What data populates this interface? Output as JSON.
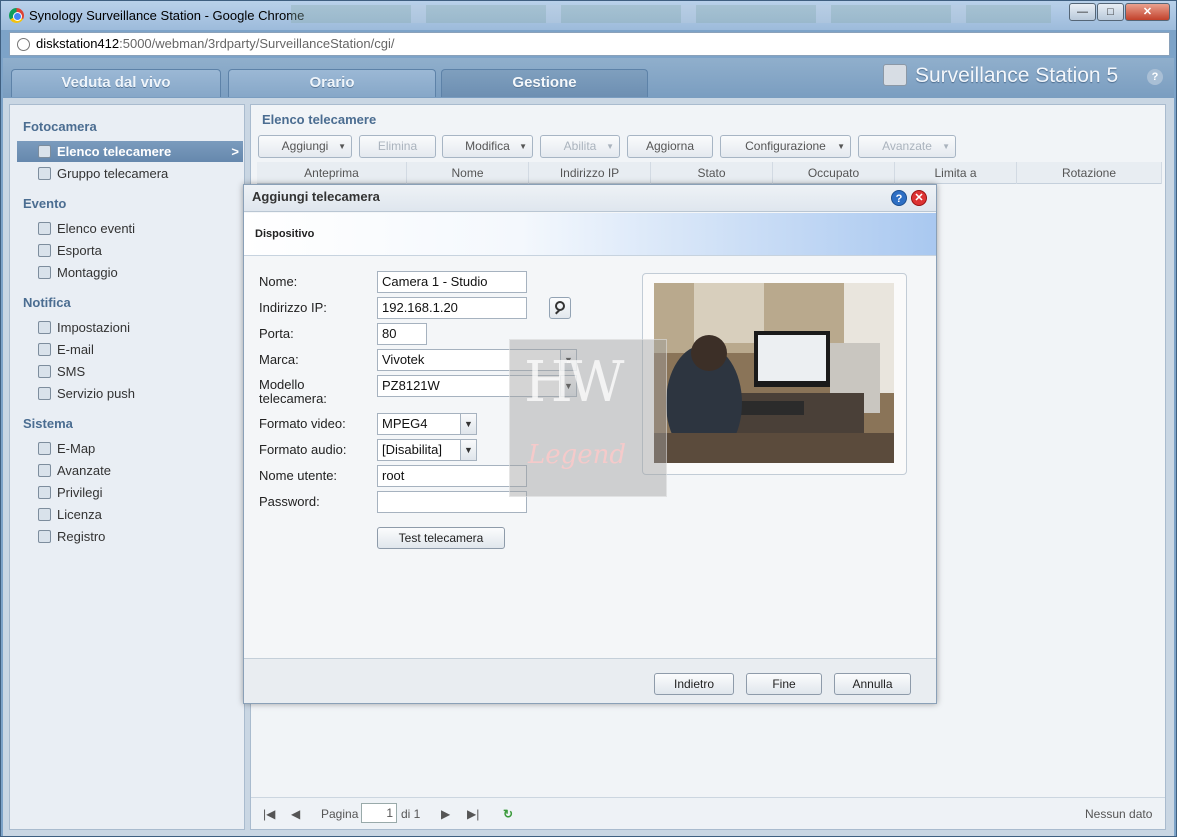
{
  "window": {
    "title": "Synology Surveillance Station - Google Chrome",
    "minimize": "—",
    "maximize": "□",
    "close": "✕"
  },
  "address": {
    "host": "diskstation412",
    "path": ":5000/webman/3rdparty/SurveillanceStation/cgi/"
  },
  "nav": {
    "tabs": [
      "Veduta dal vivo",
      "Orario",
      "Gestione"
    ],
    "active": "Gestione",
    "brand": "Surveillance Station 5",
    "help": "?"
  },
  "sidebar": {
    "sections": [
      {
        "title": "Fotocamera",
        "items": [
          "Elenco telecamere",
          "Gruppo telecamera"
        ]
      },
      {
        "title": "Evento",
        "items": [
          "Elenco eventi",
          "Esporta",
          "Montaggio"
        ]
      },
      {
        "title": "Notifica",
        "items": [
          "Impostazioni",
          "E-mail",
          "SMS",
          "Servizio push"
        ]
      },
      {
        "title": "Sistema",
        "items": [
          "E-Map",
          "Avanzate",
          "Privilegi",
          "Licenza",
          "Registro"
        ]
      }
    ],
    "selected": "Elenco telecamere",
    "selected_arrow": ">"
  },
  "main": {
    "title": "Elenco telecamere",
    "toolbar": [
      "Aggiungi",
      "Elimina",
      "Modifica",
      "Abilita",
      "Aggiorna",
      "Configurazione",
      "Avanzate"
    ],
    "columns": [
      "Anteprima",
      "Nome",
      "Indirizzo IP",
      "Stato",
      "Occupato",
      "Limita a",
      "Rotazione"
    ],
    "pager": {
      "label": "Pagina",
      "page": "1",
      "of": "di 1",
      "status": "Nessun dato"
    }
  },
  "dialog": {
    "title": "Aggiungi telecamera",
    "section": "Dispositivo",
    "help": "?",
    "close": "✕",
    "fields": {
      "name_label": "Nome:",
      "name_value": "Camera 1 - Studio",
      "ip_label": "Indirizzo IP:",
      "ip_value": "192.168.1.20",
      "port_label": "Porta:",
      "port_value": "80",
      "brand_label": "Marca:",
      "brand_value": "Vivotek",
      "model_label_1": "Modello",
      "model_label_2": "telecamera:",
      "model_value": "PZ8121W",
      "video_label": "Formato video:",
      "video_value": "MPEG4",
      "audio_label": "Formato audio:",
      "audio_value": "[Disabilita]",
      "user_label": "Nome utente:",
      "user_value": "root",
      "password_label": "Password:",
      "password_value": ""
    },
    "test_button": "Test telecamera",
    "buttons": {
      "back": "Indietro",
      "finish": "Fine",
      "cancel": "Annulla"
    }
  },
  "watermark": {
    "line1": "HW",
    "line2": "Legend"
  }
}
